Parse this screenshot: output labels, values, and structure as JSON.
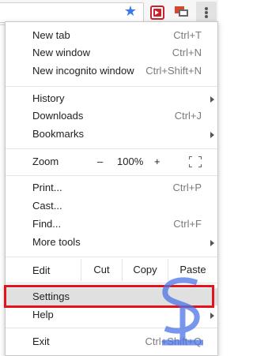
{
  "toolbar": {
    "icons": [
      "star-icon",
      "extension-red-icon",
      "cast-icon",
      "kebab-menu-icon"
    ],
    "star_color": "#3b78e7"
  },
  "menu": {
    "new_tab": {
      "label": "New tab",
      "shortcut": "Ctrl+T"
    },
    "new_window": {
      "label": "New window",
      "shortcut": "Ctrl+N"
    },
    "new_incognito": {
      "label": "New incognito window",
      "shortcut": "Ctrl+Shift+N"
    },
    "history": {
      "label": "History"
    },
    "downloads": {
      "label": "Downloads",
      "shortcut": "Ctrl+J"
    },
    "bookmarks": {
      "label": "Bookmarks"
    },
    "zoom": {
      "label": "Zoom",
      "minus": "–",
      "value": "100%",
      "plus": "+"
    },
    "print": {
      "label": "Print...",
      "shortcut": "Ctrl+P"
    },
    "cast": {
      "label": "Cast..."
    },
    "find": {
      "label": "Find...",
      "shortcut": "Ctrl+F"
    },
    "more_tools": {
      "label": "More tools"
    },
    "edit": {
      "label": "Edit",
      "cut": "Cut",
      "copy": "Copy",
      "paste": "Paste"
    },
    "settings": {
      "label": "Settings"
    },
    "help": {
      "label": "Help"
    },
    "exit": {
      "label": "Exit",
      "shortcut": "Ctrl+Shift+Q"
    }
  },
  "highlight_color": "#e3121c"
}
